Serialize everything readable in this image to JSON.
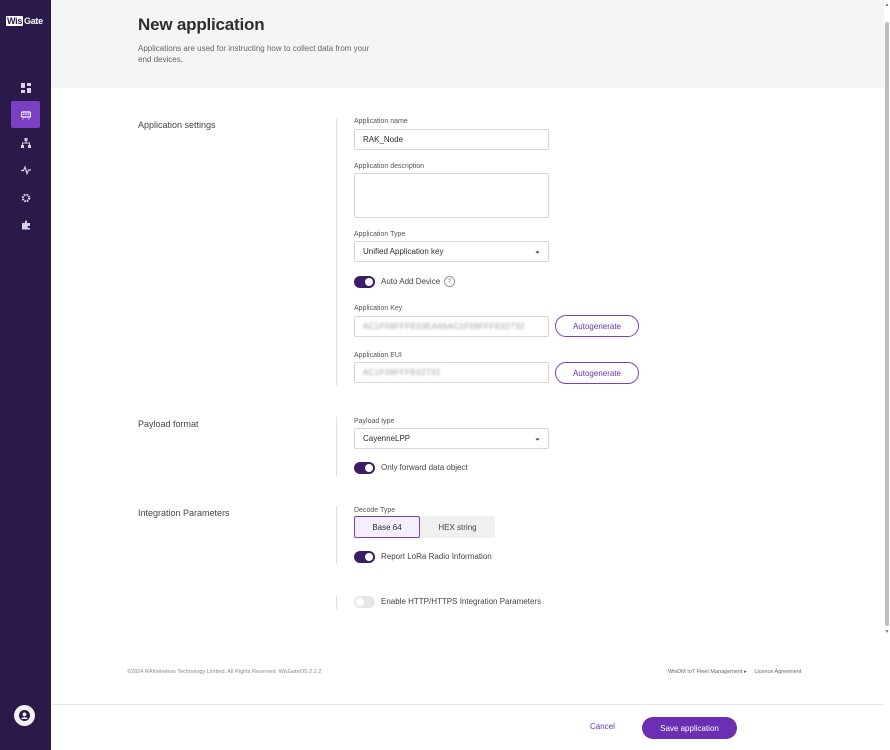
{
  "app": {
    "logo_prefix": "Wis",
    "logo_suffix": "Gate",
    "colors": {
      "sidebar": "#2a1a4a",
      "accent": "#6a2fb3",
      "active_nav": "#7b3fc4"
    }
  },
  "sidebar": {
    "items": [
      {
        "icon": "dashboard-icon",
        "active": false
      },
      {
        "icon": "applications-icon",
        "active": true
      },
      {
        "icon": "network-icon",
        "active": false
      },
      {
        "icon": "activity-icon",
        "active": false
      },
      {
        "icon": "settings-icon",
        "active": false
      },
      {
        "icon": "extensions-icon",
        "active": false
      }
    ],
    "user_icon": "user-icon"
  },
  "header": {
    "title": "New application",
    "subtitle": "Applications are used for instructing how to collect data from your end devices."
  },
  "application_settings": {
    "section_label": "Application settings",
    "name_label": "Application name",
    "name_value": "RAK_Node",
    "description_label": "Application description",
    "description_value": "",
    "type_label": "Application Type",
    "type_value": "Unified Application key",
    "auto_add_label": "Auto Add Device",
    "auto_add_on": true,
    "help_glyph": "?",
    "key_label": "Application Key",
    "key_value": "AC1F09FFFE03EA66AC1F09FFFE02732",
    "eui_label": "Application EUI",
    "eui_value": "AC1F09FFFE02732",
    "autogenerate_label": "Autogenerate"
  },
  "payload_format": {
    "section_label": "Payload format",
    "type_label": "Payload type",
    "type_value": "CayenneLPP",
    "forward_label": "Only forward data object",
    "forward_on": true
  },
  "integration": {
    "section_label": "Integration Parameters",
    "decode_label": "Decode Type",
    "decode_options": [
      "Base 64",
      "HEX string"
    ],
    "decode_selected": "Base 64",
    "lora_label": "Report LoRa Radio Information",
    "lora_on": true,
    "http_label": "Enable HTTP/HTTPS Integration Parameters",
    "http_on": false
  },
  "footer": {
    "copyright": "©2024 RAKwireless Technology Limited. All Rights Reserved. WisGateOS 2.2.2",
    "fleet_link": "WisDM IoT Fleet Management ▸",
    "licence_link": "Licence Agreement",
    "cancel_label": "Cancel",
    "save_label": "Save application"
  }
}
